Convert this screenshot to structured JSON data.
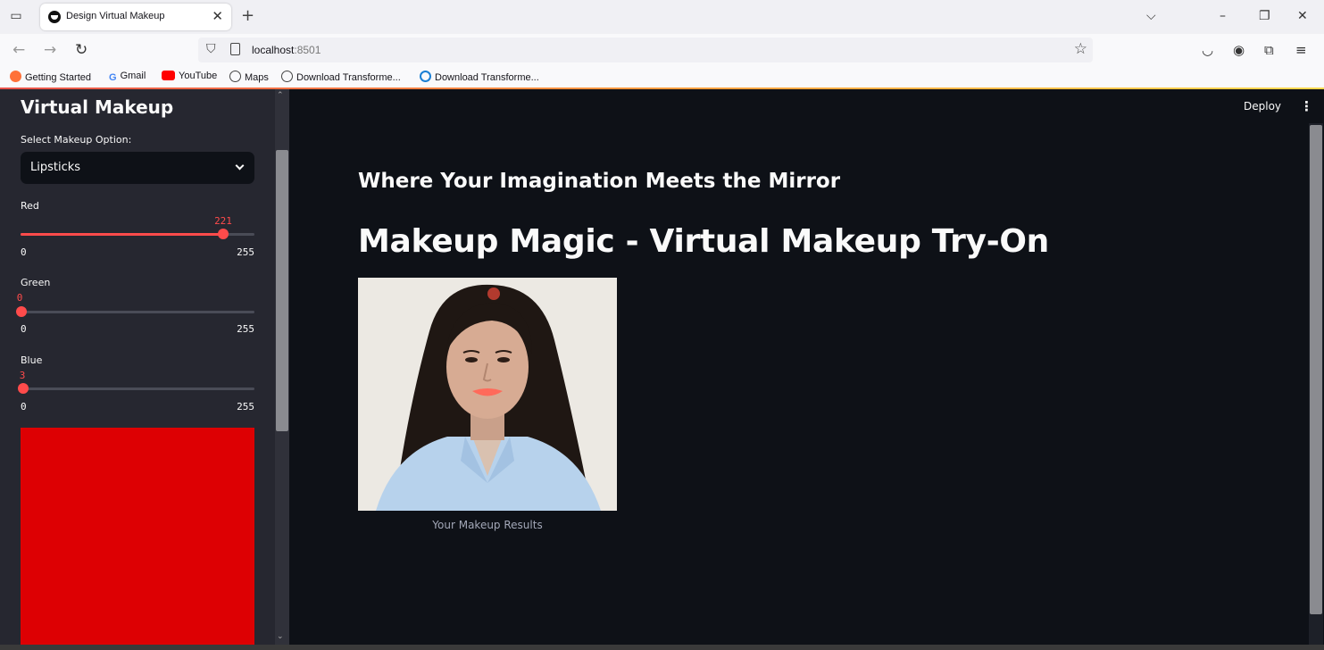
{
  "browser": {
    "tab_title": "Design Virtual Makeup",
    "tab_close": "✕",
    "new_tab": "+",
    "url_host": "localhost",
    "url_port": ":8501",
    "bookmarks": [
      "Getting Started",
      "Gmail",
      "YouTube",
      "Maps",
      "Download Transforme...",
      "Download Transforme..."
    ]
  },
  "sidebar": {
    "title": "Virtual Makeup",
    "select_label": "Select Makeup Option:",
    "select_value": "Lipsticks",
    "sliders": [
      {
        "label": "Red",
        "value": "221",
        "min": "0",
        "max": "255"
      },
      {
        "label": "Green",
        "value": "0",
        "min": "0",
        "max": "255"
      },
      {
        "label": "Blue",
        "value": "3",
        "min": "0",
        "max": "255"
      }
    ],
    "swatch_color": "#dd0003"
  },
  "main": {
    "deploy_label": "Deploy",
    "subheader": "Where Your Imagination Meets the Mirror",
    "headline": "Makeup Magic - Virtual Makeup Try-On",
    "caption": "Your Makeup Results"
  },
  "colors": {
    "accent": "#ff4b4b",
    "background": "#0e1117",
    "sidebar_bg": "#262730"
  },
  "icons": [
    "tab-list-icon",
    "close-icon",
    "back-icon",
    "forward-icon",
    "reload-icon",
    "shield-icon",
    "page-icon",
    "star-icon",
    "pocket-icon",
    "account-icon",
    "extensions-icon",
    "menu-icon",
    "kebab-icon",
    "chevron-down-icon"
  ]
}
